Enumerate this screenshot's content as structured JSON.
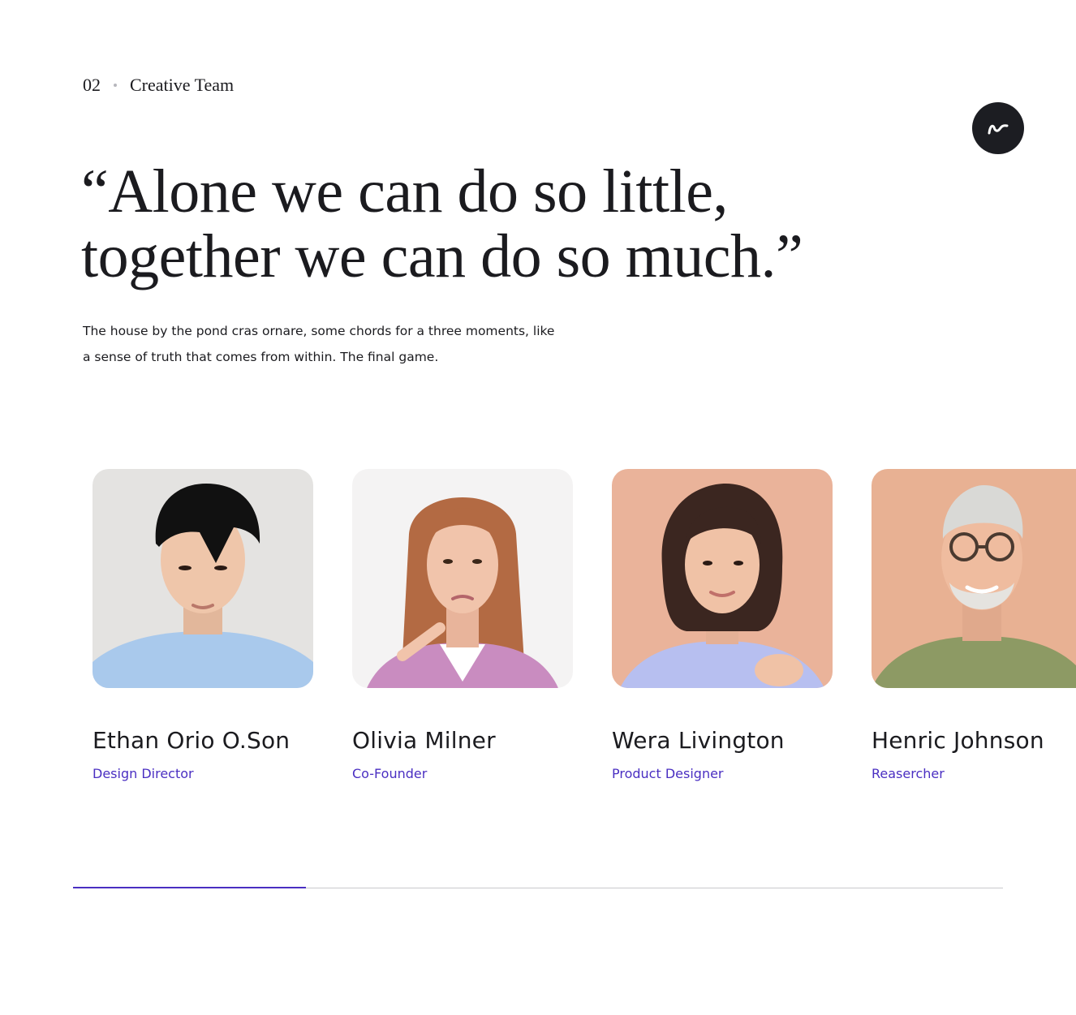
{
  "section": {
    "number": "02",
    "label": "Creative Team"
  },
  "quote": {
    "line1": "“Alone we can do so little,",
    "line2": "together we can do so much.”"
  },
  "intro": {
    "line1": "The house by the pond cras ornare, some chords for a three moments, like",
    "line2": "a sense of truth that comes from within. The final game."
  },
  "badge": {
    "icon": "squiggle-logo-icon"
  },
  "team": [
    {
      "name": "Ethan Orio O.Son",
      "role": "Design Director",
      "photo": "person-photo-young-man"
    },
    {
      "name": "Olivia Milner",
      "role": "Co-Founder",
      "photo": "person-photo-woman-long-hair"
    },
    {
      "name": "Wera Livington",
      "role": "Product Designer",
      "photo": "person-photo-woman-bob-hair"
    },
    {
      "name": "Henric Johnson",
      "role": "Reasercher",
      "photo": "person-photo-older-man"
    }
  ],
  "slider": {
    "progress": 0.25
  },
  "colors": {
    "accent": "#4a2fc2",
    "text": "#1b1b1f",
    "badge": "#1c1d22"
  }
}
